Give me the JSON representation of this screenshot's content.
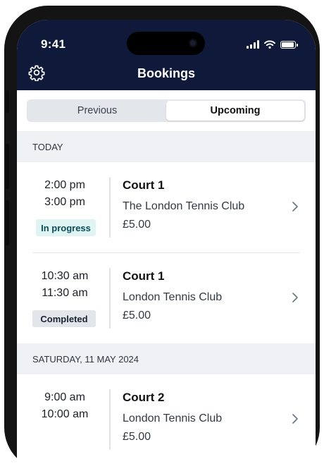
{
  "status_bar": {
    "time": "9:41"
  },
  "header": {
    "title": "Bookings",
    "settings_icon": "gear-icon"
  },
  "tabs": [
    {
      "label": "Previous",
      "active": false
    },
    {
      "label": "Upcoming",
      "active": true
    }
  ],
  "sections": [
    {
      "label": "TODAY",
      "bookings": [
        {
          "start": "2:00 pm",
          "end": "3:00 pm",
          "status": "In progress",
          "court": "Court 1",
          "club": "The London Tennis Club",
          "price": "£5.00"
        },
        {
          "start": "10:30 am",
          "end": "11:30 am",
          "status": "Completed",
          "court": "Court 1",
          "club": "London Tennis Club",
          "price": "£5.00"
        }
      ]
    },
    {
      "label": "SATURDAY, 11 MAY 2024",
      "bookings": [
        {
          "start": "9:00 am",
          "end": "10:00 am",
          "court": "Court 2",
          "club": "London Tennis Club",
          "price": "£5.00"
        }
      ]
    }
  ],
  "colors": {
    "header_bg": "#0f1a3a",
    "in_progress_bg": "#dff5f3",
    "completed_bg": "#e2e5ea"
  }
}
